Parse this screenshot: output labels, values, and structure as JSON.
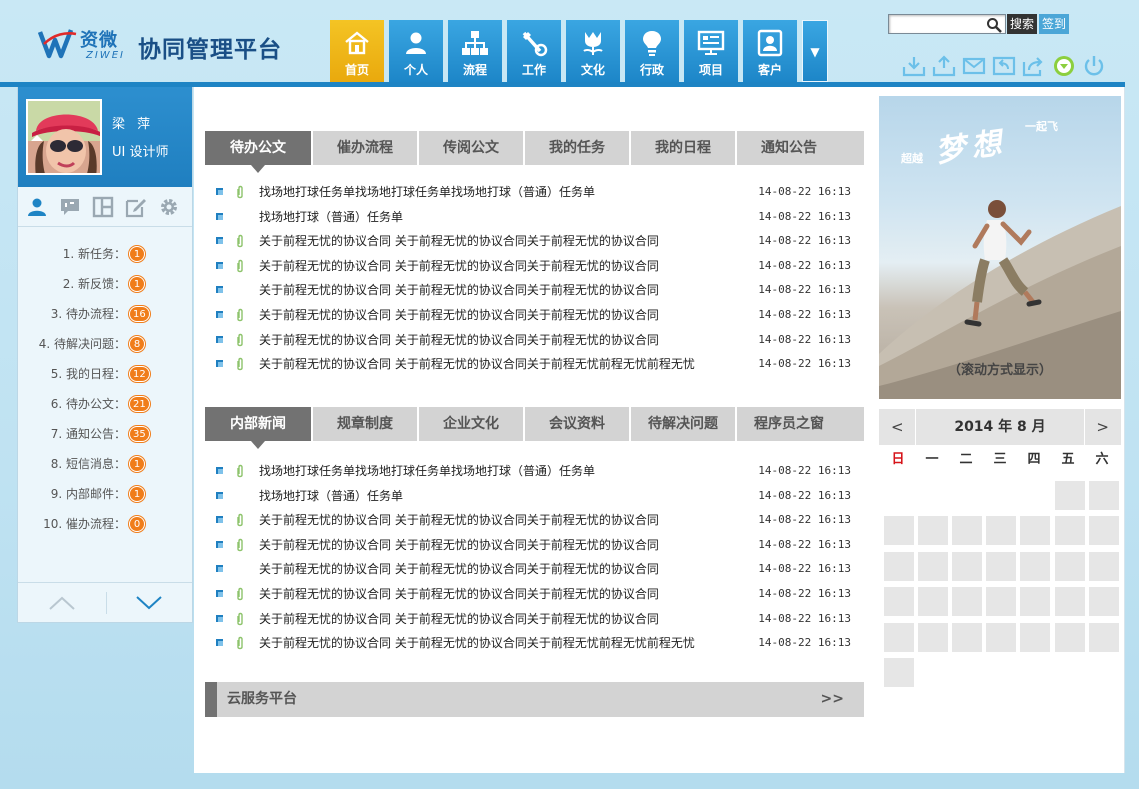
{
  "header": {
    "logo_cn": "资微",
    "logo_en": "ZIWEI",
    "app_title": "协同管理平台",
    "nav": [
      {
        "label": "首页",
        "icon": "home-icon"
      },
      {
        "label": "个人",
        "icon": "person-icon"
      },
      {
        "label": "流程",
        "icon": "flowchart-icon"
      },
      {
        "label": "工作",
        "icon": "tools-icon"
      },
      {
        "label": "文化",
        "icon": "tulip-icon"
      },
      {
        "label": "行政",
        "icon": "lightbulb-icon"
      },
      {
        "label": "项目",
        "icon": "monitor-icon"
      },
      {
        "label": "客户",
        "icon": "client-icon"
      }
    ],
    "nav_more": "▼",
    "search_placeholder": "",
    "search_button": "搜索",
    "signin_button": "签到",
    "tools": [
      "inbox-download-icon",
      "inbox-upload-icon",
      "mail-icon",
      "reply-icon",
      "share-icon",
      "down-circle-icon",
      "power-icon"
    ]
  },
  "user": {
    "name": "梁 萍",
    "role": "UI 设计师",
    "tabs": [
      "person-icon",
      "comment-icon",
      "layout-icon",
      "edit-icon",
      "gear-icon"
    ],
    "items": [
      {
        "label": "1. 新任务：",
        "count": "1"
      },
      {
        "label": "2. 新反馈：",
        "count": "1"
      },
      {
        "label": "3. 待办流程：",
        "count": "16"
      },
      {
        "label": "4. 待解决问题：",
        "count": "8"
      },
      {
        "label": "5. 我的日程：",
        "count": "12"
      },
      {
        "label": "6. 待办公文：",
        "count": "21"
      },
      {
        "label": "7. 通知公告：",
        "count": "35"
      },
      {
        "label": "8. 短信消息：",
        "count": "1"
      },
      {
        "label": "9. 内部邮件：",
        "count": "1"
      },
      {
        "label": "10. 催办流程：",
        "count": "0"
      }
    ]
  },
  "panel1": {
    "tabs": [
      "待办公文",
      "催办流程",
      "传阅公文",
      "我的任务",
      "我的日程",
      "通知公告"
    ],
    "items": [
      {
        "title": "找场地打球任务单找场地打球任务单找场地打球（普通）任务单",
        "date": "14-08-22 16:13",
        "attach": true
      },
      {
        "title": "找场地打球（普通）任务单",
        "date": "14-08-22 16:13",
        "attach": false
      },
      {
        "title": "关于前程无忧的协议合同 关于前程无忧的协议合同关于前程无忧的协议合同",
        "date": "14-08-22 16:13",
        "attach": true
      },
      {
        "title": "关于前程无忧的协议合同 关于前程无忧的协议合同关于前程无忧的协议合同",
        "date": "14-08-22 16:13",
        "attach": true
      },
      {
        "title": "关于前程无忧的协议合同 关于前程无忧的协议合同关于前程无忧的协议合同",
        "date": "14-08-22 16:13",
        "attach": false
      },
      {
        "title": "关于前程无忧的协议合同 关于前程无忧的协议合同关于前程无忧的协议合同",
        "date": "14-08-22 16:13",
        "attach": true
      },
      {
        "title": "关于前程无忧的协议合同 关于前程无忧的协议合同关于前程无忧的协议合同",
        "date": "14-08-22 16:13",
        "attach": true
      },
      {
        "title": "关于前程无忧的协议合同 关于前程无忧的协议合同关于前程无忧前程无忧前程无忧",
        "date": "14-08-22 16:13",
        "attach": true
      }
    ]
  },
  "panel2": {
    "tabs": [
      "内部新闻",
      "规章制度",
      "企业文化",
      "会议资料",
      "待解决问题",
      "程序员之窗"
    ],
    "items": [
      {
        "title": "找场地打球任务单找场地打球任务单找场地打球（普通）任务单",
        "date": "14-08-22 16:13",
        "attach": true
      },
      {
        "title": "找场地打球（普通）任务单",
        "date": "14-08-22 16:13",
        "attach": false
      },
      {
        "title": "关于前程无忧的协议合同 关于前程无忧的协议合同关于前程无忧的协议合同",
        "date": "14-08-22 16:13",
        "attach": true
      },
      {
        "title": "关于前程无忧的协议合同 关于前程无忧的协议合同关于前程无忧的协议合同",
        "date": "14-08-22 16:13",
        "attach": true
      },
      {
        "title": "关于前程无忧的协议合同 关于前程无忧的协议合同关于前程无忧的协议合同",
        "date": "14-08-22 16:13",
        "attach": false
      },
      {
        "title": "关于前程无忧的协议合同 关于前程无忧的协议合同关于前程无忧的协议合同",
        "date": "14-08-22 16:13",
        "attach": true
      },
      {
        "title": "关于前程无忧的协议合同 关于前程无忧的协议合同关于前程无忧的协议合同",
        "date": "14-08-22 16:13",
        "attach": true
      },
      {
        "title": "关于前程无忧的协议合同 关于前程无忧的协议合同关于前程无忧前程无忧前程无忧",
        "date": "14-08-22 16:13",
        "attach": true
      }
    ]
  },
  "cloud": {
    "title": "云服务平台",
    "more": ">>"
  },
  "banner": {
    "sub_left": "超越",
    "word": "梦想",
    "sub_right": "一起飞",
    "caption": "（滚动方式显示）"
  },
  "calendar": {
    "prev": "<",
    "next": ">",
    "title": "2014 年 8 月",
    "weekdays": [
      "日",
      "一",
      "二",
      "三",
      "四",
      "五",
      "六"
    ],
    "first_weekday": 5,
    "days": 31
  },
  "colors": {
    "primary": "#1e84c4",
    "accent": "#f4c424",
    "badge": "#f07d1a",
    "tab_active": "#727272"
  }
}
